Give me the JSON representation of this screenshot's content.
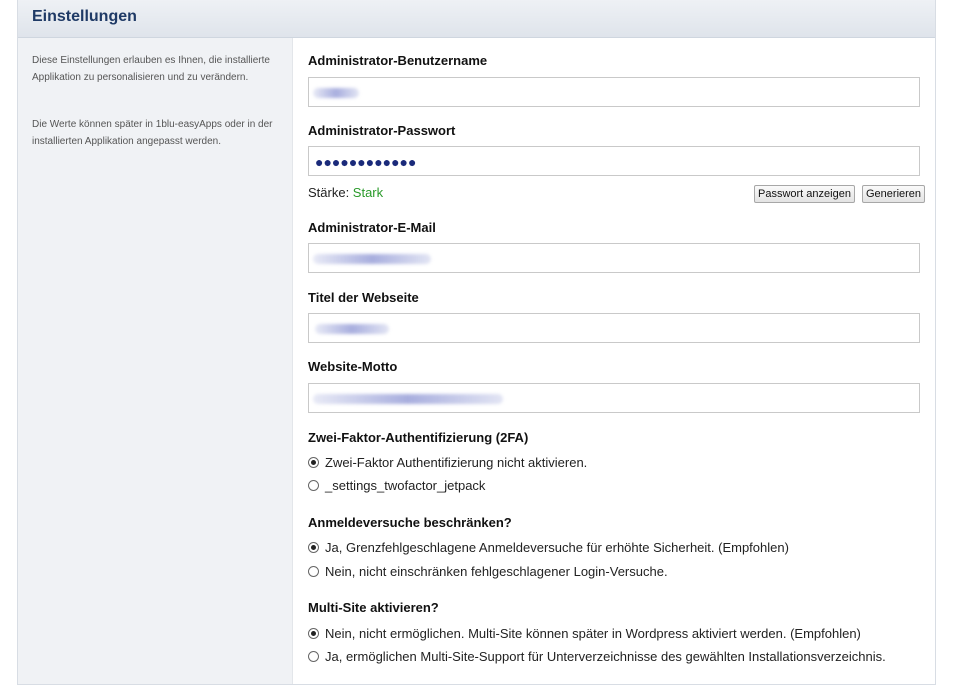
{
  "header": {
    "title": "Einstellungen"
  },
  "sidebar": {
    "paragraphs": [
      "Diese Einstellungen erlauben es Ihnen, die installierte Applikation zu personalisieren und zu verändern.",
      "Die Werte können später in 1blu-easyApps oder in der installierten Applikation angepasst werden."
    ]
  },
  "form": {
    "username_label": "Administrator-Benutzername",
    "password_label": "Administrator-Passwort",
    "password_mask": "●●●●●●●●●●●●",
    "strength_label": "Stärke: ",
    "strength_value": "Stark",
    "show_password_button": "Passwort anzeigen",
    "generate_button": "Generieren",
    "email_label": "Administrator-E-Mail",
    "site_title_label": "Titel der Webseite",
    "motto_label": "Website-Motto"
  },
  "twofa": {
    "label": "Zwei-Faktor-Authentifizierung (2FA)",
    "options": [
      {
        "label": "Zwei-Faktor Authentifizierung nicht aktivieren.",
        "checked": true
      },
      {
        "label": "_settings_twofactor_jetpack",
        "checked": false
      }
    ]
  },
  "login_limit": {
    "label": "Anmeldeversuche beschränken?",
    "options": [
      {
        "label": "Ja, Grenzfehlgeschlagene Anmeldeversuche für erhöhte Sicherheit. (Empfohlen)",
        "checked": true
      },
      {
        "label": "Nein, nicht einschränken fehlgeschlagener Login-Versuche.",
        "checked": false
      }
    ]
  },
  "multisite": {
    "label": "Multi-Site aktivieren?",
    "options": [
      {
        "label": "Nein, nicht ermöglichen. Multi-Site können später in Wordpress aktiviert werden. (Empfohlen)",
        "checked": true
      },
      {
        "label": "Ja, ermöglichen Multi-Site-Support für Unterverzeichnisse des gewählten Installationsverzeichnis.",
        "checked": false
      }
    ]
  },
  "colors": {
    "title": "#1f3a66",
    "strength_strong": "#2a9a2a"
  }
}
